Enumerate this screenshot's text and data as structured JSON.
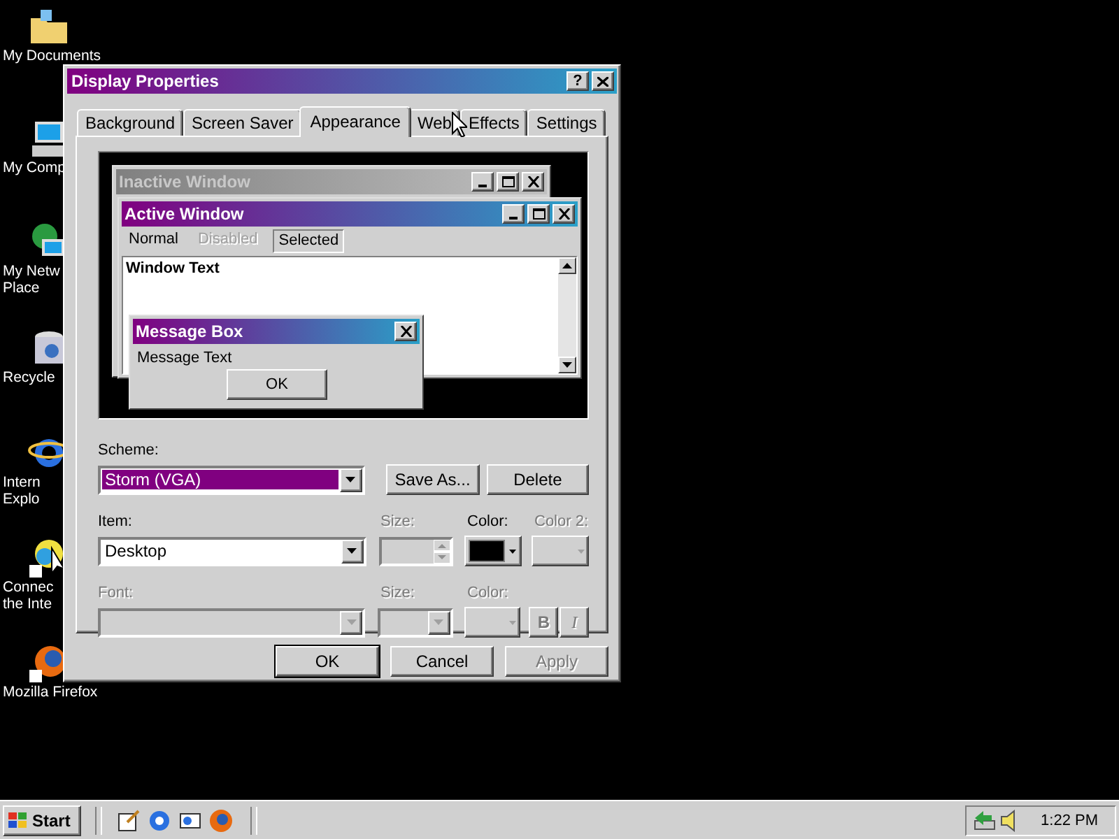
{
  "desktop_icons": [
    {
      "kind": "folder",
      "label": [
        "My Documents"
      ]
    },
    {
      "kind": "computer",
      "label": [
        "My Comp"
      ]
    },
    {
      "kind": "network",
      "label": [
        "My Netw",
        "Place"
      ]
    },
    {
      "kind": "recycle",
      "label": [
        "Recycle"
      ]
    },
    {
      "kind": "browser",
      "label": [
        "Intern",
        "Explo"
      ]
    },
    {
      "kind": "connect",
      "label": [
        "Connec",
        "the Inte"
      ]
    },
    {
      "kind": "firefox",
      "label": [
        "Mozilla Firefox"
      ]
    }
  ],
  "dialog": {
    "title": "Display Properties",
    "help": "?",
    "tabs": [
      {
        "label": "Background",
        "selected": false
      },
      {
        "label": "Screen Saver",
        "selected": false
      },
      {
        "label": "Appearance",
        "selected": true
      },
      {
        "label": "Web",
        "selected": false
      },
      {
        "label": "Effects",
        "selected": false
      },
      {
        "label": "Settings",
        "selected": false
      }
    ],
    "preview": {
      "inactive_title": "Inactive Window",
      "active_title": "Active Window",
      "menu": [
        {
          "label": "Normal",
          "disabled": false,
          "selected": false
        },
        {
          "label": "Disabled",
          "disabled": true,
          "selected": false
        },
        {
          "label": "Selected",
          "disabled": false,
          "selected": true
        }
      ],
      "window_text": "Window Text",
      "message_title": "Message Box",
      "message_text": "Message Text",
      "ok": "OK"
    },
    "scheme": {
      "label": "Scheme:",
      "value": "Storm (VGA)",
      "save_as": "Save As...",
      "delete": "Delete"
    },
    "item_row": {
      "item_label": "Item:",
      "item_value": "Desktop",
      "size_label": "Size:",
      "size_disabled": true,
      "color_label": "Color:",
      "color": "#000000",
      "color2_label": "Color 2:",
      "color2_disabled": true
    },
    "font_row": {
      "font_label": "Font:",
      "size_label": "Size:",
      "color_label": "Color:",
      "bold": "B",
      "italic": "I",
      "disabled": true
    },
    "buttons": [
      {
        "label": "OK",
        "disabled": false,
        "default": true
      },
      {
        "label": "Cancel",
        "disabled": false,
        "default": false
      },
      {
        "label": "Apply",
        "disabled": true,
        "default": false
      }
    ]
  },
  "taskbar": {
    "start": "Start",
    "quick_launch": [
      {
        "kind": "desktop"
      },
      {
        "kind": "browser"
      },
      {
        "kind": "channels"
      },
      {
        "kind": "firefox"
      }
    ],
    "clock": "1:22 PM"
  }
}
